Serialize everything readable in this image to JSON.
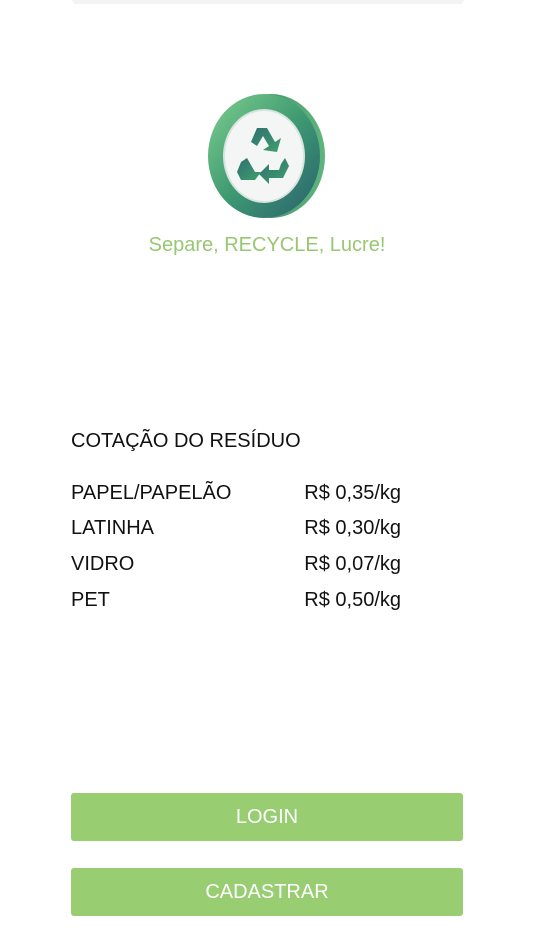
{
  "brand": {
    "tagline": "Separe, RECYCLE, Lucre!",
    "logo_icon": "recycle-coin-icon",
    "colors": {
      "tagline": "#98c771",
      "button": "#98cd72",
      "coin_face": "#ffffff",
      "coin_rim": "#3b8c6e",
      "recycle_arrows": "#2e8a6b"
    }
  },
  "quotes": {
    "title": "COTAÇÃO DO RESÍDUO",
    "items": [
      {
        "name": "PAPEL/PAPELÃO",
        "price": "R$ 0,35/kg"
      },
      {
        "name": "LATINHA",
        "price": "R$ 0,30/kg"
      },
      {
        "name": "VIDRO",
        "price": "R$ 0,07/kg"
      },
      {
        "name": "PET",
        "price": "R$ 0,50/kg"
      }
    ]
  },
  "actions": {
    "login_label": "LOGIN",
    "register_label": "CADASTRAR"
  }
}
